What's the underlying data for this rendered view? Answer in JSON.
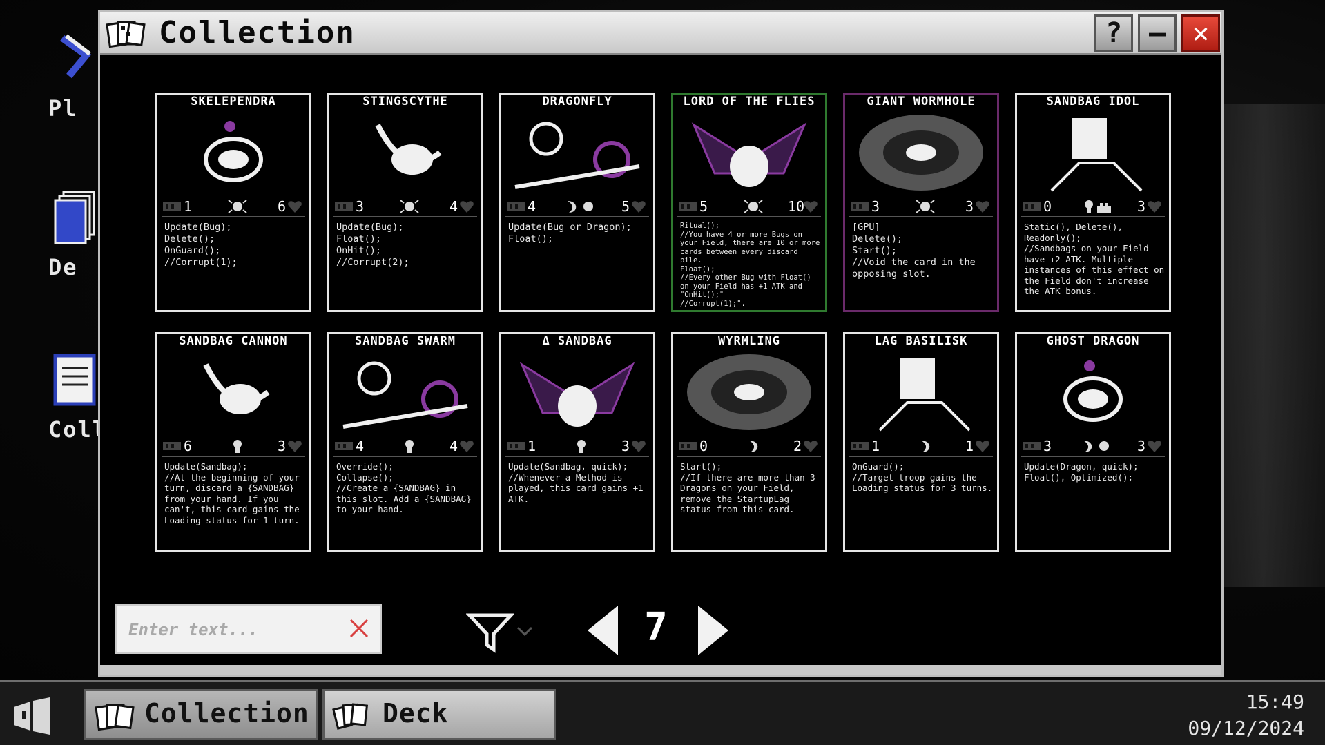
{
  "window": {
    "title": "Collection",
    "help_label": "?",
    "min_label": "—",
    "close_label": "✕"
  },
  "desktop_icons": [
    {
      "label": "Pl",
      "icon": "play-icon"
    },
    {
      "label": "De",
      "icon": "deck-stack-icon"
    },
    {
      "label": "Colle",
      "icon": "collection-book-icon"
    }
  ],
  "cards": [
    {
      "name": "SKELEPENDRA",
      "cost": "1",
      "atk": "6",
      "types": "bug",
      "border": "white",
      "desc": "Update(Bug);\nDelete();\nOnGuard();\n//Corrupt(1);",
      "size": "normal"
    },
    {
      "name": "STINGSCYTHE",
      "cost": "3",
      "atk": "4",
      "types": "bug",
      "border": "white",
      "desc": "Update(Bug);\nFloat();\nOnHit();\n//Corrupt(2);",
      "size": "normal"
    },
    {
      "name": "DRAGONFLY",
      "cost": "4",
      "atk": "5",
      "types": "dragon-bug",
      "border": "white",
      "desc": "Update(Bug or Dragon);\nFloat();",
      "size": "normal"
    },
    {
      "name": "LORD OF THE FLIES",
      "cost": "5",
      "atk": "10",
      "types": "bug",
      "border": "green",
      "desc": "Ritual();\n//You have 4 or more Bugs on your Field, there are 10 or more cards between every discard pile.\nFloat();\n//Every other Bug with Float() on your Field has +1 ATK and \"OnHit();\"\n//Corrupt(1);\".",
      "size": "small"
    },
    {
      "name": "GIANT WORMHOLE",
      "cost": "3",
      "atk": "3",
      "types": "bug",
      "border": "purple",
      "desc": "[GPU]\nDelete();\nStart();\n//Void the card in the opposing slot.",
      "size": "normal"
    },
    {
      "name": "SANDBAG IDOL",
      "cost": "0",
      "atk": "3",
      "types": "sandbag-castle",
      "border": "white",
      "desc": "Static(), Delete(), Readonly();\n//Sandbags on your Field have +2 ATK. Multiple instances of this effect on the Field don't increase the ATK bonus.",
      "size": "mid"
    },
    {
      "name": "SANDBAG CANNON",
      "cost": "6",
      "atk": "3",
      "types": "sandbag",
      "border": "white",
      "desc": "Update(Sandbag);\n//At the beginning of your turn, discard a {SANDBAG} from your hand. If you can't, this card gains the Loading status for 1 turn.",
      "size": "mid"
    },
    {
      "name": "SANDBAG SWARM",
      "cost": "4",
      "atk": "4",
      "types": "sandbag",
      "border": "white",
      "desc": "Override();\nCollapse();\n//Create a {SANDBAG} in this slot. Add a {SANDBAG} to your hand.",
      "size": "mid"
    },
    {
      "name": "Δ SANDBAG",
      "cost": "1",
      "atk": "3",
      "types": "sandbag",
      "border": "white",
      "desc": "Update(Sandbag, quick);\n//Whenever a Method is played, this card gains +1 ATK.",
      "size": "mid"
    },
    {
      "name": "WYRMLING",
      "cost": "0",
      "atk": "2",
      "types": "dragon",
      "border": "white",
      "desc": "Start();\n//If there are more than 3 Dragons on your Field, remove the StartupLag status from this card.",
      "size": "mid"
    },
    {
      "name": "LAG BASILISK",
      "cost": "1",
      "atk": "1",
      "types": "dragon",
      "border": "white",
      "desc": "OnGuard();\n//Target troop gains the Loading status for 3 turns.",
      "size": "mid"
    },
    {
      "name": "GHOST DRAGON",
      "cost": "3",
      "atk": "3",
      "types": "dragon-bug",
      "border": "white",
      "desc": "Update(Dragon, quick);\nFloat(), Optimized();",
      "size": "mid"
    }
  ],
  "search": {
    "placeholder": "Enter text...",
    "value": ""
  },
  "pager": {
    "page": "7"
  },
  "taskbar": {
    "items": [
      {
        "label": "Collection",
        "icon": "collection-cards-icon",
        "active": true
      },
      {
        "label": "Deck",
        "icon": "deck-cards-icon",
        "active": false
      }
    ],
    "time": "15:49",
    "date": "09/12/2024"
  },
  "colors": {
    "accent_close": "#c8271b",
    "clear_x": "#d84040",
    "legendary_green": "#2f7a2f",
    "rare_purple": "#6a2a6a"
  }
}
